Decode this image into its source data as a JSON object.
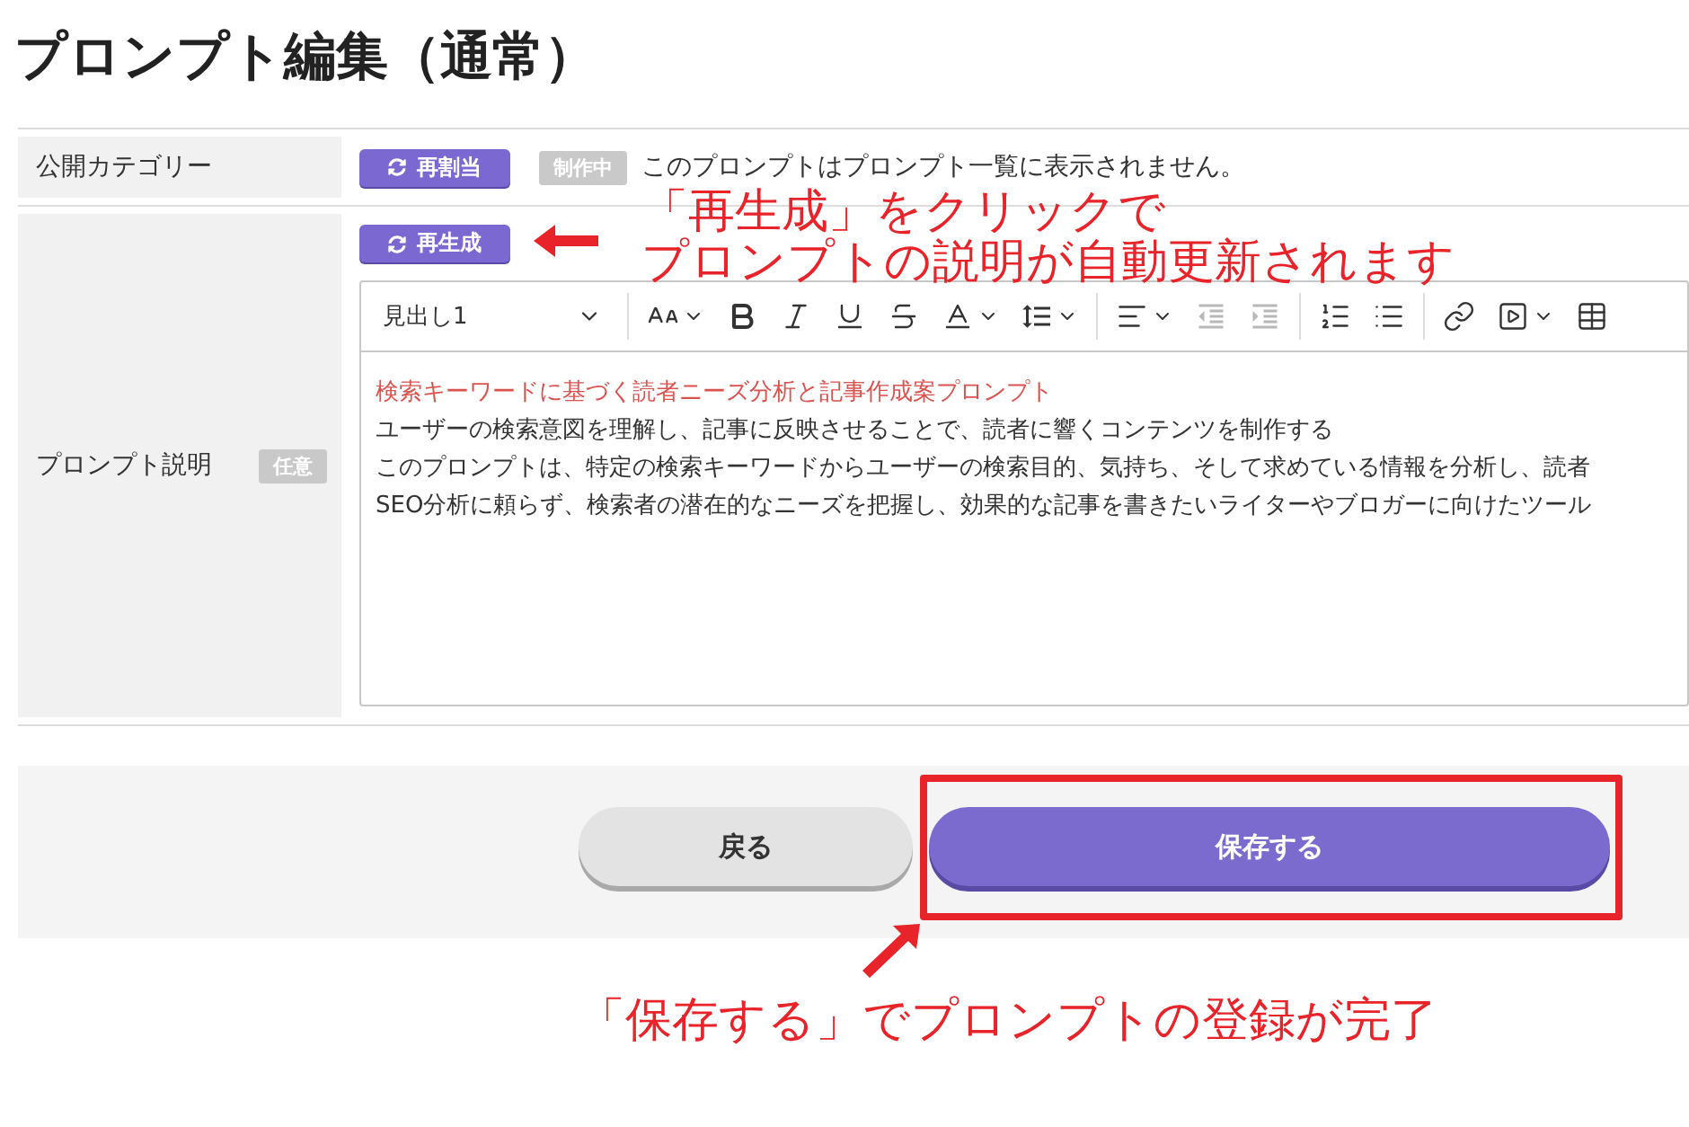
{
  "page_title": "プロンプト編集（通常）",
  "category_row": {
    "label": "公開カテゴリー",
    "button": "再割当",
    "status_badge": "制作中",
    "note": "このプロンプトはプロンプト一覧に表示されません。"
  },
  "description_row": {
    "label": "プロンプト説明",
    "optional_badge": "任意",
    "button": "再生成",
    "editor": {
      "heading_select": "見出し1",
      "toolbar_groups": [
        [
          {
            "kind": "font-size",
            "menu": true,
            "disabled": false
          },
          {
            "kind": "bold",
            "menu": false,
            "disabled": false
          },
          {
            "kind": "italic",
            "menu": false,
            "disabled": false
          },
          {
            "kind": "underline",
            "menu": false,
            "disabled": false
          },
          {
            "kind": "strikethrough",
            "menu": false,
            "disabled": false
          },
          {
            "kind": "font-color",
            "menu": true,
            "disabled": false
          },
          {
            "kind": "line-height",
            "menu": true,
            "disabled": false
          }
        ],
        [
          {
            "kind": "align",
            "menu": true,
            "disabled": false
          },
          {
            "kind": "outdent",
            "menu": false,
            "disabled": true
          },
          {
            "kind": "indent",
            "menu": false,
            "disabled": true
          }
        ],
        [
          {
            "kind": "numbered-list",
            "menu": false,
            "disabled": false
          },
          {
            "kind": "bulleted-list",
            "menu": false,
            "disabled": false
          }
        ],
        [
          {
            "kind": "link",
            "menu": false,
            "disabled": false
          },
          {
            "kind": "media",
            "menu": true,
            "disabled": false
          },
          {
            "kind": "table",
            "menu": false,
            "disabled": false
          }
        ]
      ],
      "lines": [
        {
          "kind": "heading",
          "text": "検索キーワードに基づく読者ニーズ分析と記事作成案プロンプト"
        },
        {
          "kind": "paragraph",
          "text": "ユーザーの検索意図を理解し、記事に反映させることで、読者に響くコンテンツを制作する"
        },
        {
          "kind": "paragraph",
          "text": "このプロンプトは、特定の検索キーワードからユーザーの検索目的、気持ち、そして求めている情報を分析し、読者"
        },
        {
          "kind": "paragraph",
          "text": "SEO分析に頼らず、検索者の潜在的なニーズを把握し、効果的な記事を書きたいライターやブロガーに向けたツール"
        }
      ]
    }
  },
  "footer": {
    "buttons": [
      {
        "kind": "secondary",
        "label": "戻る"
      },
      {
        "kind": "primary",
        "label": "保存する"
      }
    ]
  },
  "annotations": [
    {
      "kind": "regenerate-note",
      "lines": [
        "「再生成」をクリックで",
        "プロンプトの説明が自動更新されます"
      ]
    },
    {
      "kind": "save-note",
      "lines": [
        "「保存する」でプロンプトの登録が完了"
      ]
    }
  ]
}
